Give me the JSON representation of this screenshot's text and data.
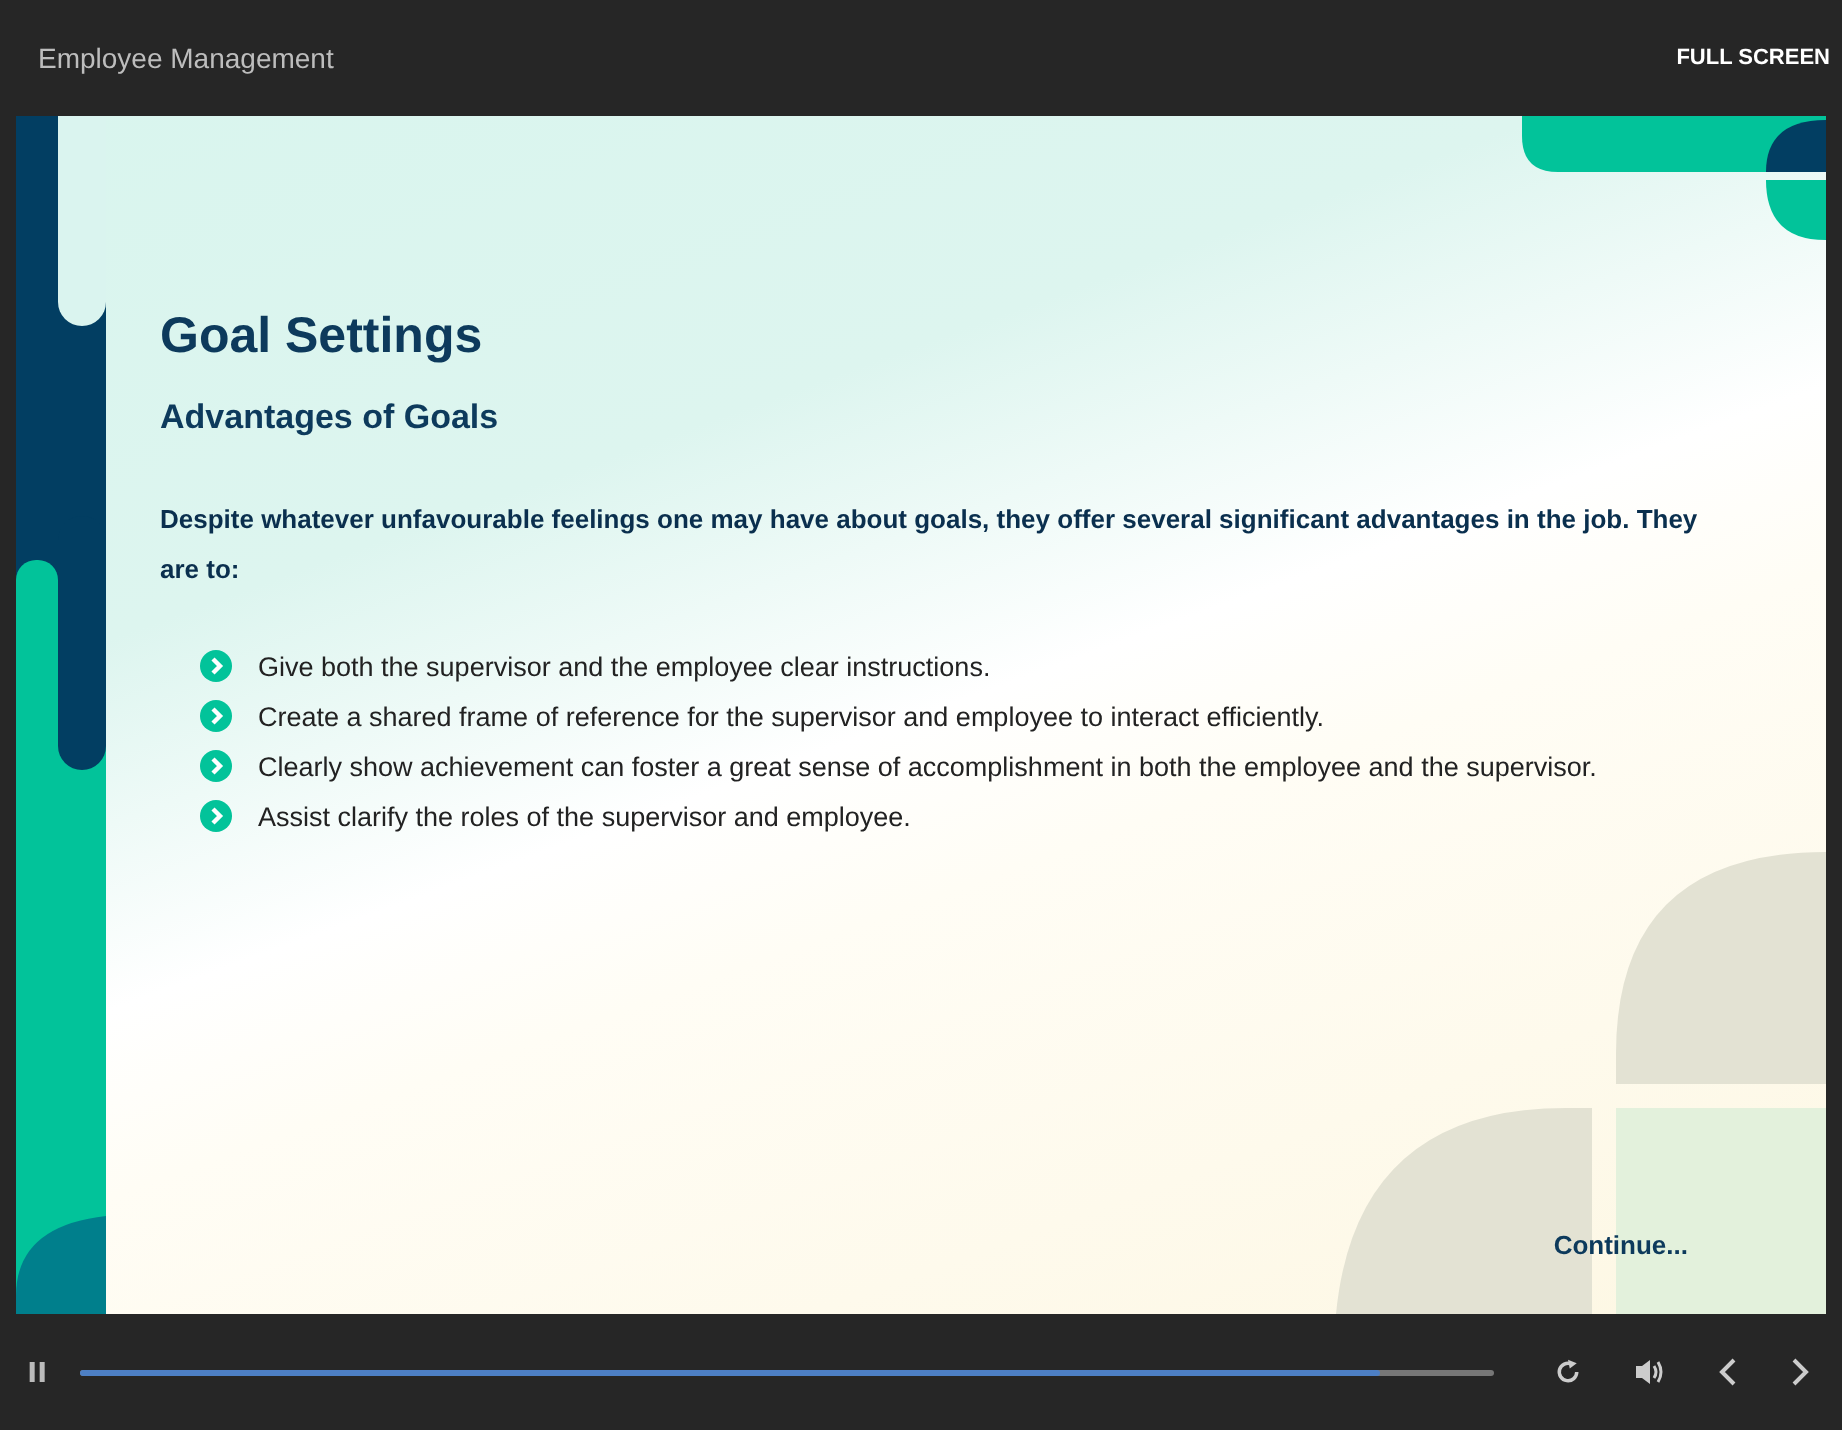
{
  "header": {
    "title": "Employee Management",
    "full_screen_button": "FULL SCREEN"
  },
  "slide": {
    "title": "Goal Settings",
    "subtitle": "Advantages of Goals",
    "intro": "Despite whatever unfavourable feelings one may have about goals, they offer several significant advantages in the job. They are to:",
    "bullets": [
      "Give both the supervisor and the employee clear instructions.",
      "Create a shared frame of reference for the supervisor and employee to interact efficiently.",
      "Clearly show achievement can foster a great sense of accomplishment in both the employee and the supervisor.",
      "Assist clarify the roles of the supervisor and employee."
    ],
    "continue_link": "Continue..."
  },
  "player": {
    "playing": true,
    "progress": {
      "level": 0.92
    }
  }
}
